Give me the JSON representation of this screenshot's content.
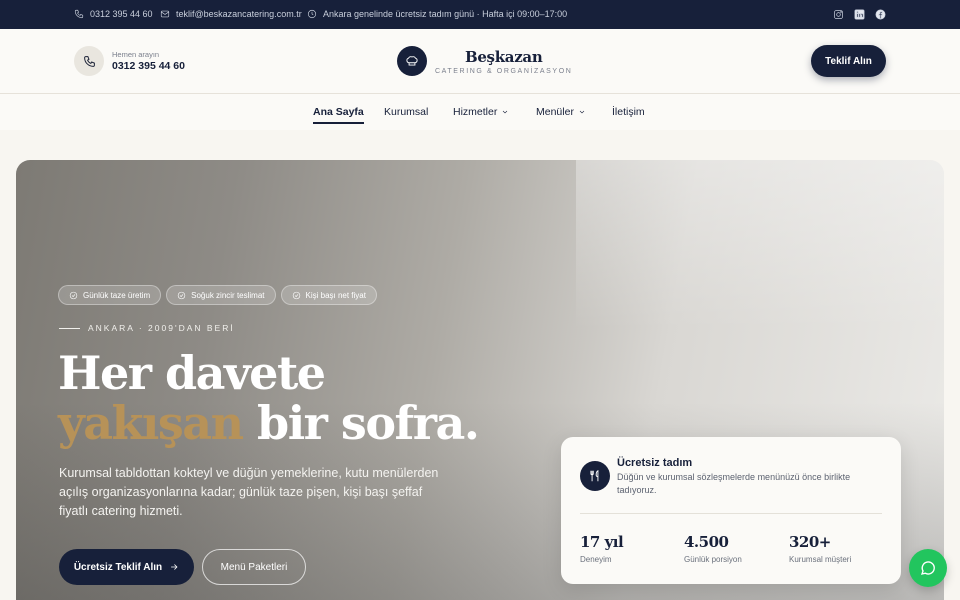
{
  "topbar": {
    "phone": "0312 395 44 60",
    "email": "teklif@beskazancatering.com.tr",
    "hours": "Ankara genelinde ücretsiz tadım günü · Hafta içi 09:00–17:00",
    "social": [
      "instagram-icon",
      "linkedin-icon",
      "facebook-icon"
    ]
  },
  "header": {
    "call_label": "Hemen arayın",
    "call_number": "0312 395 44 60",
    "brand_name": "Beşkazan",
    "brand_sub": "CATERING & ORGANİZASYON",
    "cta": "Teklif Alın"
  },
  "nav": {
    "items": [
      {
        "label": "Ana Sayfa"
      },
      {
        "label": "Kurumsal"
      },
      {
        "label": "Hizmetler"
      },
      {
        "label": "Menüler"
      },
      {
        "label": "İletişim"
      }
    ]
  },
  "hero": {
    "pills": [
      "Günlük taze üretim",
      "Soğuk zincir teslimat",
      "Kişi başı net fiyat"
    ],
    "eyebrow": "ANKARA · 2009'DAN BERİ",
    "title_line1": "Her davete",
    "title_gold": "yakışan",
    "title_rest": " bir sofra.",
    "lead": "Kurumsal tabldottan kokteyl ve düğün yemeklerine, kutu menülerden açılış organizasyonlarına kadar; günlük taze pişen, kişi başı şeffaf fiyatlı catering hizmeti.",
    "primary_btn": "Ücretsiz Teklif Alın",
    "secondary_btn": "Menü Paketleri"
  },
  "card": {
    "title": "Ücretsiz tadım",
    "desc": "Düğün ve kurumsal sözleşmelerde menünüzü önce birlikte tadıyoruz.",
    "stats": [
      {
        "value": "17 yıl",
        "label": "Deneyim"
      },
      {
        "value": "4.500",
        "label": "Günlük porsiyon"
      },
      {
        "value": "320+",
        "label": "Kurumsal müşteri"
      }
    ]
  },
  "colors": {
    "navy": "#17203a",
    "gold": "#b79258",
    "whatsapp": "#22c55e"
  }
}
